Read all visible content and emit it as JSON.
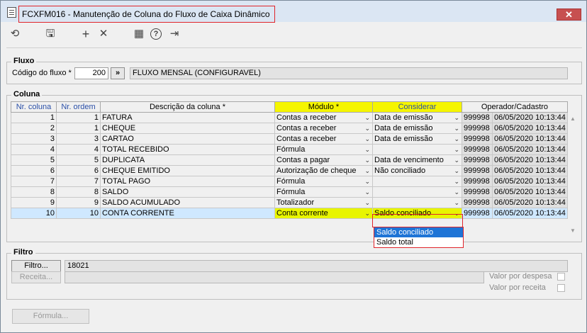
{
  "window": {
    "title": "FCXFM016 - Manutenção de Coluna do Fluxo de Caixa Dinâmico",
    "close_glyph": "✕"
  },
  "toolbar": {
    "buttons": [
      {
        "name": "refresh-icon",
        "glyph": "⟲"
      },
      {
        "name": "save-icon",
        "glyph": "🖫"
      },
      {
        "name": "add-icon",
        "glyph": "+"
      },
      {
        "name": "delete-icon",
        "glyph": "✕"
      },
      {
        "name": "calendar-icon",
        "glyph": "▦"
      },
      {
        "name": "help-icon",
        "glyph": "?"
      },
      {
        "name": "exit-icon",
        "glyph": "⇥"
      }
    ]
  },
  "fluxo": {
    "section_label": "Fluxo",
    "code_label": "Código do fluxo *",
    "code_value": "200",
    "lookup_label": "»",
    "description": "FLUXO MENSAL (CONFIGURAVEL)"
  },
  "coluna": {
    "section_label": "Coluna",
    "headers": [
      "Nr. coluna",
      "Nr. ordem",
      "Descrição da coluna *",
      "Módulo *",
      "Considerar",
      "Operador/Cadastro"
    ],
    "rows": [
      {
        "nr": "1",
        "ordem": "1",
        "desc": "FATURA",
        "modulo": "Contas a receber",
        "considerar": "Data de emissão",
        "operador": "999998",
        "cadastro": "06/05/2020 10:13:44"
      },
      {
        "nr": "2",
        "ordem": "1",
        "desc": "CHEQUE",
        "modulo": "Contas a receber",
        "considerar": "Data de emissão",
        "operador": "999998",
        "cadastro": "06/05/2020 10:13:44"
      },
      {
        "nr": "3",
        "ordem": "3",
        "desc": "CARTAO",
        "modulo": "Contas a receber",
        "considerar": "Data de emissão",
        "operador": "999998",
        "cadastro": "06/05/2020 10:13:44"
      },
      {
        "nr": "4",
        "ordem": "4",
        "desc": "TOTAL RECEBIDO",
        "modulo": "Fórmula",
        "considerar": "",
        "operador": "999998",
        "cadastro": "06/05/2020 10:13:44"
      },
      {
        "nr": "5",
        "ordem": "5",
        "desc": "DUPLICATA",
        "modulo": "Contas a pagar",
        "considerar": "Data de vencimento",
        "operador": "999998",
        "cadastro": "06/05/2020 10:13:44"
      },
      {
        "nr": "6",
        "ordem": "6",
        "desc": "CHEQUE EMITIDO",
        "modulo": "Autorização de cheque",
        "considerar": "Não conciliado",
        "operador": "999998",
        "cadastro": "06/05/2020 10:13:44"
      },
      {
        "nr": "7",
        "ordem": "7",
        "desc": "TOTAL PAGO",
        "modulo": "Fórmula",
        "considerar": "",
        "operador": "999998",
        "cadastro": "06/05/2020 10:13:44"
      },
      {
        "nr": "8",
        "ordem": "8",
        "desc": "SALDO",
        "modulo": "Fórmula",
        "considerar": "",
        "operador": "999998",
        "cadastro": "06/05/2020 10:13:44"
      },
      {
        "nr": "9",
        "ordem": "9",
        "desc": "SALDO ACUMULADO",
        "modulo": "Totalizador",
        "considerar": "",
        "operador": "999998",
        "cadastro": "06/05/2020 10:13:44"
      },
      {
        "nr": "10",
        "ordem": "10",
        "desc": "CONTA CORRENTE",
        "modulo": "Conta corrente",
        "considerar": "Saldo conciliado",
        "operador": "999998",
        "cadastro": "06/05/2020 10:13:44"
      }
    ],
    "dropdown_options": [
      "Saldo conciliado",
      "Saldo total"
    ]
  },
  "filtro": {
    "section_label": "Filtro",
    "filtro_button": "Filtro...",
    "filtro_value": "18021",
    "receita_button": "Receita...",
    "receita_value": "",
    "valor_despesa_label": "Valor por despesa",
    "valor_receita_label": "Valor por receita",
    "formula_button": "Fórmula..."
  }
}
